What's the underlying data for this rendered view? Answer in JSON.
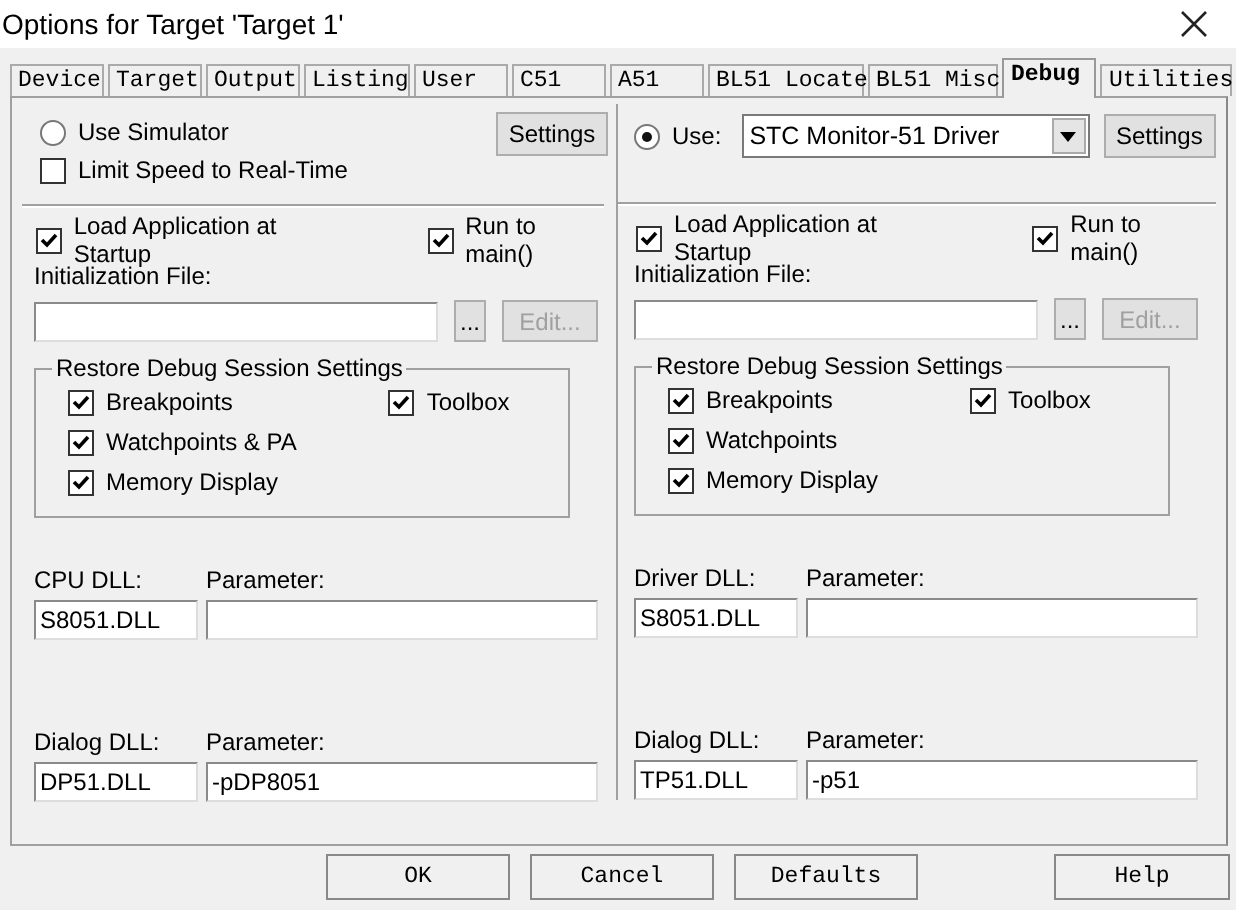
{
  "window": {
    "title": "Options for Target 'Target 1'"
  },
  "tabs": [
    {
      "label": "Device",
      "selected": false
    },
    {
      "label": "Target",
      "selected": false
    },
    {
      "label": "Output",
      "selected": false
    },
    {
      "label": "Listing",
      "selected": false
    },
    {
      "label": "User",
      "selected": false
    },
    {
      "label": "C51",
      "selected": false
    },
    {
      "label": "A51",
      "selected": false
    },
    {
      "label": "BL51 Locate",
      "selected": false
    },
    {
      "label": "BL51 Misc",
      "selected": false
    },
    {
      "label": "Debug",
      "selected": true
    },
    {
      "label": "Utilities",
      "selected": false
    }
  ],
  "panes": [
    {
      "kind": "simulator",
      "mode": {
        "label": "Use Simulator",
        "selected": false
      },
      "settings_button": "Settings",
      "limit_speed": {
        "label": "Limit Speed to Real-Time",
        "checked": false
      },
      "load_app": {
        "label": "Load Application at Startup",
        "checked": true
      },
      "run_to_main": {
        "label": "Run to main()",
        "checked": true
      },
      "init_file": {
        "label": "Initialization File:"
      },
      "browse_button": "...",
      "edit_button": {
        "label": "Edit...",
        "disabled": true
      },
      "restore_group": {
        "title": "Restore Debug Session Settings",
        "columns": [
          [
            {
              "label": "Breakpoints",
              "checked": true
            },
            {
              "label": "Watchpoints & PA",
              "checked": true
            },
            {
              "label": "Memory Display",
              "checked": true
            }
          ],
          [
            {
              "label": "Toolbox",
              "checked": true
            }
          ]
        ]
      },
      "dlls": [
        {
          "label": "CPU DLL:",
          "value": "S8051.DLL",
          "param_label": "Parameter:"
        },
        {
          "label": "Dialog DLL:",
          "value": "DP51.DLL",
          "param_label": "Parameter:",
          "param_value": "-pDP8051"
        }
      ]
    },
    {
      "kind": "driver",
      "mode": {
        "label": "Use:",
        "selected": true
      },
      "driver": {
        "value": "STC Monitor-51 Driver"
      },
      "settings_button": "Settings",
      "load_app": {
        "label": "Load Application at Startup",
        "checked": true
      },
      "run_to_main": {
        "label": "Run to main()",
        "checked": true
      },
      "init_file": {
        "label": "Initialization File:"
      },
      "browse_button": "...",
      "edit_button": {
        "label": "Edit...",
        "disabled": true
      },
      "restore_group": {
        "title": "Restore Debug Session Settings",
        "columns": [
          [
            {
              "label": "Breakpoints",
              "checked": true
            },
            {
              "label": "Watchpoints",
              "checked": true
            },
            {
              "label": "Memory Display",
              "checked": true
            }
          ],
          [
            {
              "label": "Toolbox",
              "checked": true
            }
          ]
        ]
      },
      "dlls": [
        {
          "label": "Driver DLL:",
          "value": "S8051.DLL",
          "param_label": "Parameter:"
        },
        {
          "label": "Dialog DLL:",
          "value": "TP51.DLL",
          "param_label": "Parameter:",
          "param_value": "-p51"
        }
      ]
    }
  ],
  "buttons": [
    {
      "label": "OK"
    },
    {
      "label": "Cancel"
    },
    {
      "label": "Defaults"
    },
    {
      "label": "Help"
    }
  ]
}
